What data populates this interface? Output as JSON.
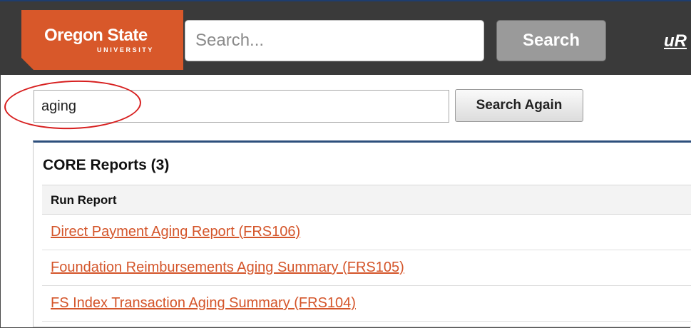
{
  "header": {
    "logo_name": "Oregon State",
    "logo_subtitle": "UNIVERSITY",
    "search_placeholder": "Search...",
    "search_button": "Search",
    "user_link": "uR"
  },
  "search_again": {
    "value": "aging",
    "button": "Search Again"
  },
  "results": {
    "title": "CORE Reports (3)",
    "column_header": "Run Report",
    "rows": [
      "Direct Payment Aging Report (FRS106)",
      "Foundation Reimbursements Aging Summary (FRS105)",
      "FS Index Transaction Aging Summary (FRS104)"
    ]
  },
  "colors": {
    "brand_orange": "#d8582a",
    "header_bg": "#3a3a3a",
    "link": "#d4552a",
    "highlight_annotation": "#d71f1f"
  }
}
